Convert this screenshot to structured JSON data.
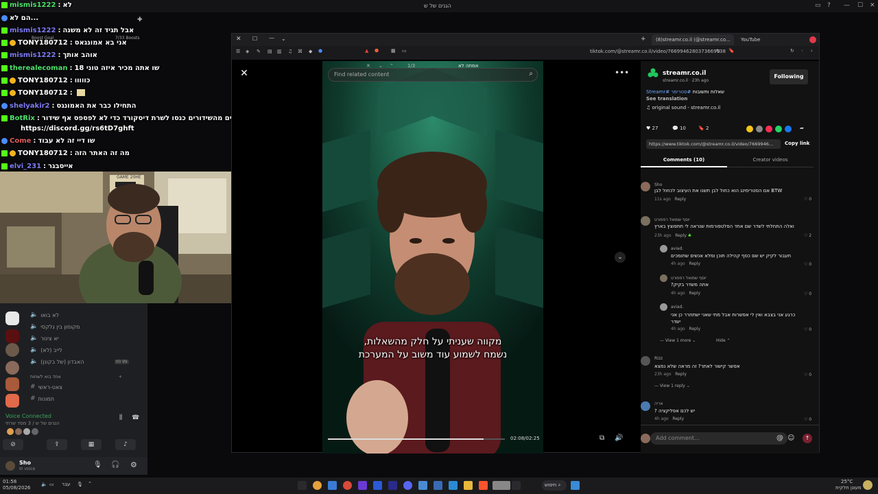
{
  "system": {
    "window_title": "הגנים של ש",
    "clock_time": "01:58",
    "clock_date": "05/08/2026",
    "lang": "עבר",
    "weather_temp": "25°C",
    "weather_desc": "מעונן חלקית",
    "search_label": "חיפוש"
  },
  "chat": {
    "lines": [
      {
        "user": "mismis1222",
        "msg": "לא"
      },
      {
        "user": "",
        "msg": "הם לא..."
      },
      {
        "user": "mismis1222",
        "msg": "אבל תגיד זה לא משנה"
      },
      {
        "user": "TONY180712",
        "msg": "אני בא אמונגאס"
      },
      {
        "user": "mismis1222",
        "msg": "אוהב אותך"
      },
      {
        "user": "therealecoman",
        "msg": "18 שו אתה מכיר איזה טוני"
      },
      {
        "user": "TONY180712",
        "msg": "כווווו"
      },
      {
        "user": "TONY180712",
        "msg": ""
      },
      {
        "user": "shelyakir2",
        "msg": "התחילו כבר את האמונגס"
      },
      {
        "user": "BotRix",
        "msg": "אם אתם נהנים מהשידורים כנסו לשרת דיסקורד כדי לא לפספס אף שידור!"
      },
      {
        "user": "",
        "msg": "https://discord.gg/rs6tD7ghft"
      },
      {
        "user": "Come",
        "msg": "שו דיי זה לא עבוד"
      },
      {
        "user": "TONY180712",
        "msg": "מה זה האתר הזה"
      },
      {
        "user": "elvi_231",
        "msg": "אייסבגר"
      }
    ],
    "boosts": "7/33 Boosts",
    "boost_goal": "Boost Goal"
  },
  "discord": {
    "channels": [
      {
        "label": "לא בואו",
        "icon": "speaker"
      },
      {
        "label": "מקומון בין גלקסי",
        "icon": "speaker"
      },
      {
        "label": "יא צינור",
        "icon": "speaker"
      },
      {
        "label": "לייב (לא)",
        "icon": "speaker"
      },
      {
        "label": "האבדון (של בקונן)",
        "icon": "speaker"
      },
      {
        "label": "אחד בוא לשחות",
        "icon": "category"
      },
      {
        "label": "צאט-ראשי",
        "icon": "hash"
      },
      {
        "label": "תמונות",
        "icon": "hash"
      }
    ],
    "voice_status": "Voice Connected",
    "voice_channel": "הגנים של ש / 3 מסד שרתי",
    "user_name": "Sho",
    "user_status": "In voice",
    "counter": "00 99"
  },
  "browser": {
    "tabs": [
      {
        "label": "(8)streamr.co.il (@streamr.co...",
        "active": true
      },
      {
        "label": "YouTube",
        "active": false
      }
    ],
    "url": "tiktok.com/@streamr.co.il/video/7669946280373669138",
    "find_text": "אמתה לא",
    "find_count": "1/3"
  },
  "tiktok": {
    "search_placeholder": "Find related content",
    "subtitle_line1": "מקווה שעניתי על חלק מהשאלות,",
    "subtitle_line2": "נשמח לשמוע עוד משוב על המערכת",
    "time": "02:08/02:25",
    "progress": 0.88,
    "author": "streamr.co.il",
    "author_sub": "streamr.co.il · 23h ago",
    "follow_label": "Following",
    "description": "שאלות ותשובות",
    "tags": "#סטרימר #Streamr",
    "see_translation": "See translation",
    "sound": "original sound - streamr.co.il",
    "likes": "27",
    "comments_count": "10",
    "saves": "2",
    "link": "https://www.tiktok.com/@streamr.co.il/video/7669946...",
    "copy_link": "Copy link",
    "tab_comments": "Comments (10)",
    "tab_creator": "Creator videos",
    "add_comment_placeholder": "Add comment...",
    "comments": [
      {
        "name": "Sho",
        "text": "BTW אם הסטרימינג הוא כחול לבן תשנו את העיצוב לכחול לבן",
        "time": "11s ago",
        "reply": "Reply",
        "likes": "0"
      },
      {
        "name": "יוסף שמואל רפפורט",
        "text": "ואלה התחלתי לשדר שם אחד הפלטפורמות שנראה לי תתפוצץ בארץ",
        "time": "23h ago",
        "reply": "Reply",
        "likes": "2"
      },
      {
        "name": "aviad.",
        "text": "תעבור לקיק יש שם כסף קהילה תוכן ומלא אנשים שתומכים",
        "time": "4h ago",
        "reply": "Reply",
        "likes": "0"
      },
      {
        "name": "יוסף שמואל רפפורט",
        "text": "אתה משדר בקיק?",
        "time": "4h ago",
        "reply": "Reply",
        "likes": "0"
      },
      {
        "name": "aviad.",
        "text": "כרגע אני בצבא ואין לי אפשרות אבל מתי שאני ישתחרר כן אני ישדר",
        "time": "4h ago",
        "reply": "Reply",
        "likes": "0"
      },
      {
        "name": "Rizz",
        "text": "אפשר קישור לאתר? זה מראה שלא נמצא",
        "time": "23h ago",
        "reply": "Reply",
        "likes": "0"
      },
      {
        "name": "אריה",
        "text": "יש לכם אפליקציה ?",
        "time": "4h ago",
        "reply": "Reply",
        "likes": "0"
      }
    ],
    "view_more": "View 1 more",
    "hide": "Hide",
    "view_reply": "View 1 reply"
  },
  "colors": {
    "kick_green": "#53fc18",
    "tiktok_red": "#fe2c55",
    "discord_bg": "#1e1f22"
  }
}
